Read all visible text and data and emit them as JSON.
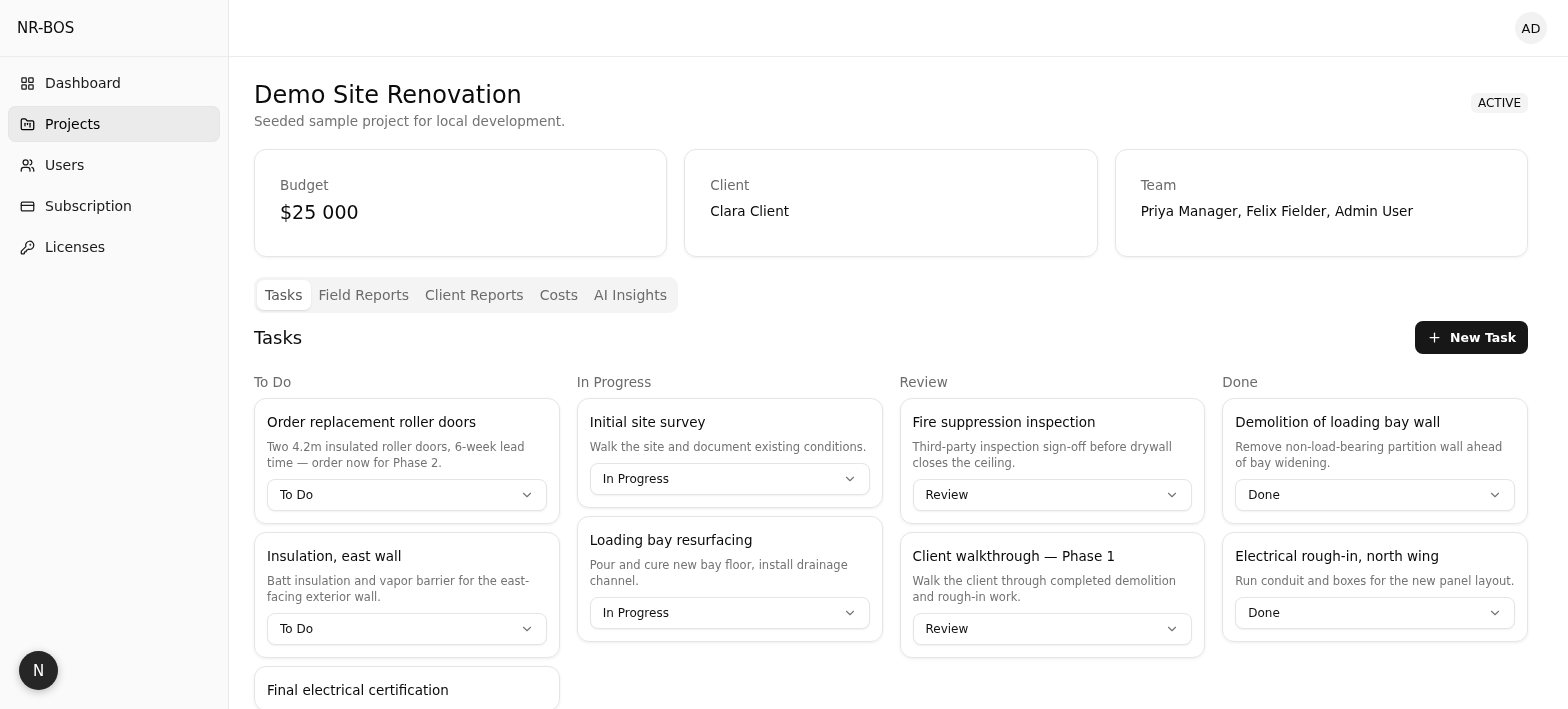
{
  "brand": "NR-BOS",
  "sidebar": {
    "items": [
      {
        "label": "Dashboard",
        "selected": false
      },
      {
        "label": "Projects",
        "selected": true
      },
      {
        "label": "Users",
        "selected": false
      },
      {
        "label": "Subscription",
        "selected": false
      },
      {
        "label": "Licenses",
        "selected": false
      }
    ]
  },
  "dev_badge": "N",
  "user_avatar": "AD",
  "project": {
    "title": "Demo Site Renovation",
    "subtitle": "Seeded sample project for local development.",
    "status": "ACTIVE"
  },
  "stats": [
    {
      "label": "Budget",
      "value": "$25 000",
      "kind": "large"
    },
    {
      "label": "Client",
      "value": "Clara Client",
      "kind": "normal"
    },
    {
      "label": "Team",
      "value": "Priya Manager, Felix Fielder, Admin User",
      "kind": "normal"
    }
  ],
  "tabs": [
    {
      "label": "Tasks",
      "selected": true
    },
    {
      "label": "Field Reports",
      "selected": false
    },
    {
      "label": "Client Reports",
      "selected": false
    },
    {
      "label": "Costs",
      "selected": false
    },
    {
      "label": "AI Insights",
      "selected": false
    }
  ],
  "section_title": "Tasks",
  "new_task_button": "New Task",
  "columns": [
    {
      "title": "To Do",
      "cards": [
        {
          "title": "Order replacement roller doors",
          "description": "Two 4.2m insulated roller doors, 6-week lead time — order now for Phase 2.",
          "status": "To Do"
        },
        {
          "title": "Insulation, east wall",
          "description": "Batt insulation and vapor barrier for the east-facing exterior wall.",
          "status": "To Do"
        },
        {
          "title": "Final electrical certification"
        }
      ]
    },
    {
      "title": "In Progress",
      "cards": [
        {
          "title": "Initial site survey",
          "description": "Walk the site and document existing conditions.",
          "status": "In Progress"
        },
        {
          "title": "Loading bay resurfacing",
          "description": "Pour and cure new bay floor, install drainage channel.",
          "status": "In Progress"
        }
      ]
    },
    {
      "title": "Review",
      "cards": [
        {
          "title": "Fire suppression inspection",
          "description": "Third-party inspection sign-off before drywall closes the ceiling.",
          "status": "Review"
        },
        {
          "title": "Client walkthrough — Phase 1",
          "description": "Walk the client through completed demolition and rough-in work.",
          "status": "Review"
        }
      ]
    },
    {
      "title": "Done",
      "cards": [
        {
          "title": "Demolition of loading bay wall",
          "description": "Remove non-load-bearing partition wall ahead of bay widening.",
          "status": "Done"
        },
        {
          "title": "Electrical rough-in, north wing",
          "description": "Run conduit and boxes for the new panel layout.",
          "status": "Done"
        }
      ]
    }
  ]
}
